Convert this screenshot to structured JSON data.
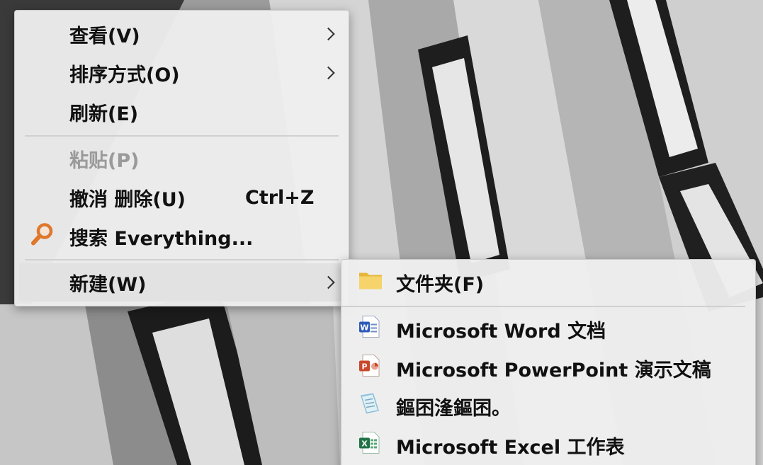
{
  "main_menu": {
    "items": [
      {
        "label": "查看(V)"
      },
      {
        "label": "排序方式(O)"
      },
      {
        "label": "刷新(E)"
      },
      {
        "label": "粘贴(P)"
      },
      {
        "label": "撤消 删除(U)",
        "shortcut": "Ctrl+Z"
      },
      {
        "label": "搜索 Everything...",
        "icon": "search-icon"
      },
      {
        "label": "新建(W)"
      }
    ]
  },
  "new_submenu": {
    "items": [
      {
        "label": "文件夹(F)",
        "icon": "folder-icon"
      },
      {
        "label": "Microsoft Word 文档",
        "icon": "word-document-icon"
      },
      {
        "label": "Microsoft PowerPoint 演示文稿",
        "icon": "powerpoint-document-icon"
      },
      {
        "label": "鏂囨湰鏂囨。",
        "icon": "text-document-icon"
      },
      {
        "label": "Microsoft Excel 工作表",
        "icon": "excel-document-icon"
      }
    ]
  },
  "colors": {
    "menu_bg": "#eeeeee",
    "hover_bg": "#e2e2e2",
    "disabled_text": "#9a9a9a",
    "folder": "#f3c74a",
    "word": "#2b5bb8",
    "powerpoint": "#c9472b",
    "excel": "#207245",
    "search_icon": "#e0772a"
  }
}
